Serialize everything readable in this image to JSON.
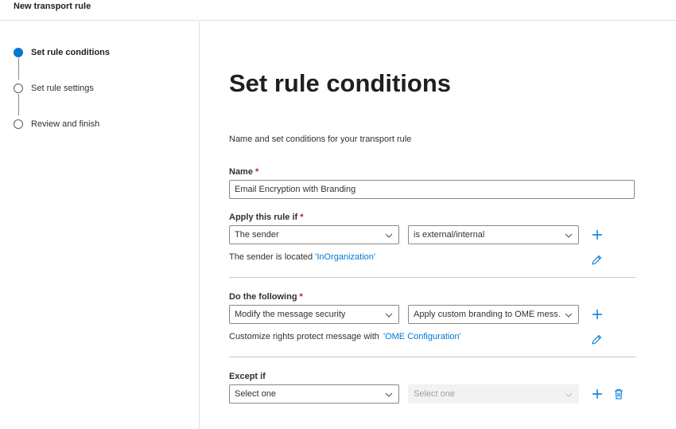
{
  "app": {
    "title": "New transport rule"
  },
  "steps": [
    {
      "label": "Set rule conditions",
      "state": "active"
    },
    {
      "label": "Set rule settings",
      "state": "pending"
    },
    {
      "label": "Review and finish",
      "state": "pending"
    }
  ],
  "main": {
    "title": "Set rule conditions",
    "description": "Name and set conditions for your transport rule"
  },
  "name_field": {
    "label": "Name",
    "required": "*",
    "value": "Email Encryption with Branding"
  },
  "apply_if": {
    "label": "Apply this rule if",
    "required": "*",
    "condition": "The sender",
    "operator": "is external/internal",
    "summary_prefix": "The sender is located",
    "summary_value": "'InOrganization'"
  },
  "do_following": {
    "label": "Do the following",
    "required": "*",
    "action": "Modify the message security",
    "option": "Apply custom branding to OME mess...",
    "summary_prefix": "Customize rights protect message with",
    "summary_value": "'OME Configuration'"
  },
  "except_if": {
    "label": "Except if",
    "condition": "Select one",
    "operator": "Select one"
  },
  "colors": {
    "accent": "#0078d4",
    "required": "#a4262c",
    "border": "#8a8886"
  },
  "icons": [
    "add-icon",
    "edit-icon",
    "delete-icon",
    "chevron-down-icon"
  ]
}
